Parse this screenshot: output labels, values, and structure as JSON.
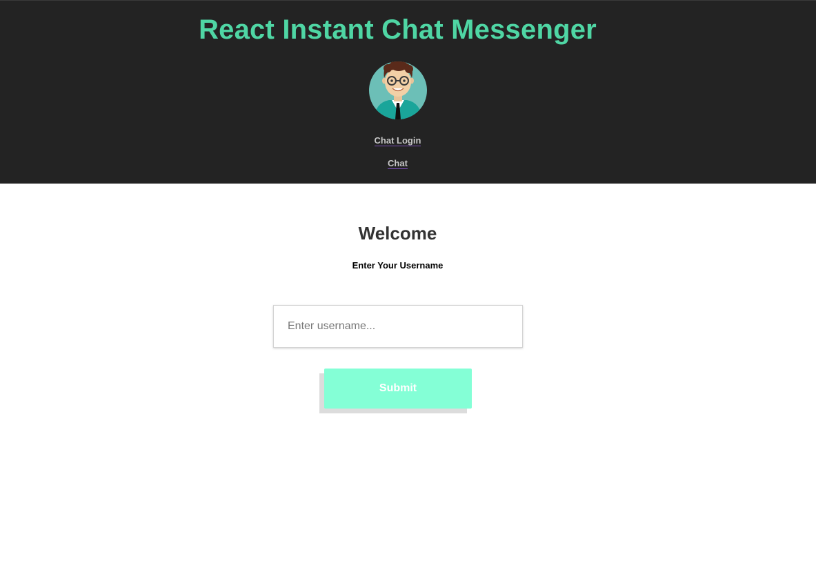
{
  "header": {
    "title": "React Instant Chat Messenger",
    "title_color": "#4fd6a4",
    "background_color": "#232323",
    "avatar_icon": "cartoon-man-avatar-icon",
    "nav": {
      "login_label": "Chat Login",
      "chat_label": "Chat"
    }
  },
  "main": {
    "heading": "Welcome",
    "subheading": "Enter Your Username",
    "username_input": {
      "value": "",
      "placeholder": "Enter username..."
    },
    "submit_label": "Submit",
    "submit_color": "#84ffd6"
  }
}
